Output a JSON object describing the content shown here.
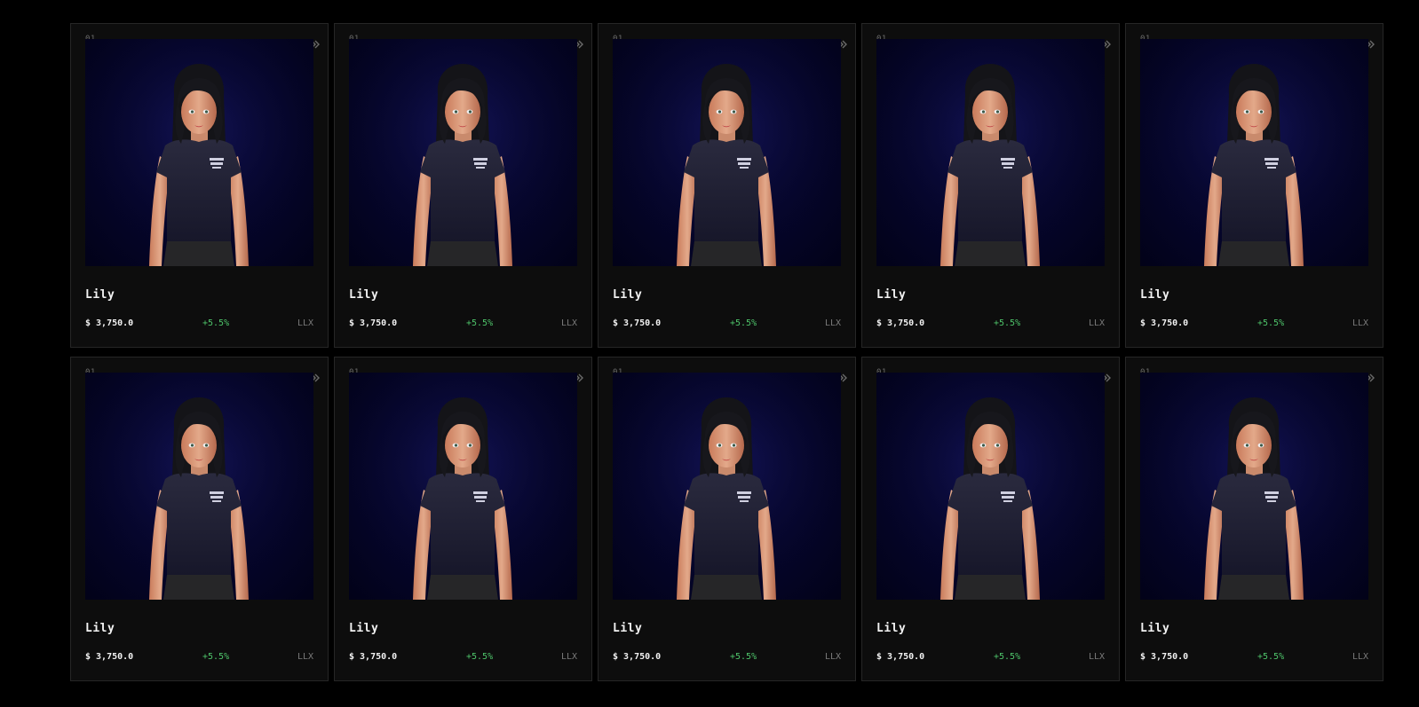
{
  "colors": {
    "background": "#000000",
    "card_background": "#0d0d0d",
    "card_border": "#262626",
    "positive": "#4ec46a",
    "muted": "#7a7a7a",
    "image_background": "#05052a"
  },
  "cards": [
    {
      "index": "01",
      "title": "Lily",
      "price": "$ 3,750.0",
      "change": "+5.5%",
      "ticker": "LLX",
      "icon": "double-chevron-right-icon"
    },
    {
      "index": "01",
      "title": "Lily",
      "price": "$ 3,750.0",
      "change": "+5.5%",
      "ticker": "LLX",
      "icon": "double-chevron-right-icon"
    },
    {
      "index": "01",
      "title": "Lily",
      "price": "$ 3,750.0",
      "change": "+5.5%",
      "ticker": "LLX",
      "icon": "double-chevron-right-icon"
    },
    {
      "index": "01",
      "title": "Lily",
      "price": "$ 3,750.0",
      "change": "+5.5%",
      "ticker": "LLX",
      "icon": "double-chevron-right-icon"
    },
    {
      "index": "01",
      "title": "Lily",
      "price": "$ 3,750.0",
      "change": "+5.5%",
      "ticker": "LLX",
      "icon": "double-chevron-right-icon"
    },
    {
      "index": "01",
      "title": "Lily",
      "price": "$ 3,750.0",
      "change": "+5.5%",
      "ticker": "LLX",
      "icon": "double-chevron-right-icon"
    },
    {
      "index": "01",
      "title": "Lily",
      "price": "$ 3,750.0",
      "change": "+5.5%",
      "ticker": "LLX",
      "icon": "double-chevron-right-icon"
    },
    {
      "index": "01",
      "title": "Lily",
      "price": "$ 3,750.0",
      "change": "+5.5%",
      "ticker": "LLX",
      "icon": "double-chevron-right-icon"
    },
    {
      "index": "01",
      "title": "Lily",
      "price": "$ 3,750.0",
      "change": "+5.5%",
      "ticker": "LLX",
      "icon": "double-chevron-right-icon"
    },
    {
      "index": "01",
      "title": "Lily",
      "price": "$ 3,750.0",
      "change": "+5.5%",
      "ticker": "LLX",
      "icon": "double-chevron-right-icon"
    }
  ]
}
